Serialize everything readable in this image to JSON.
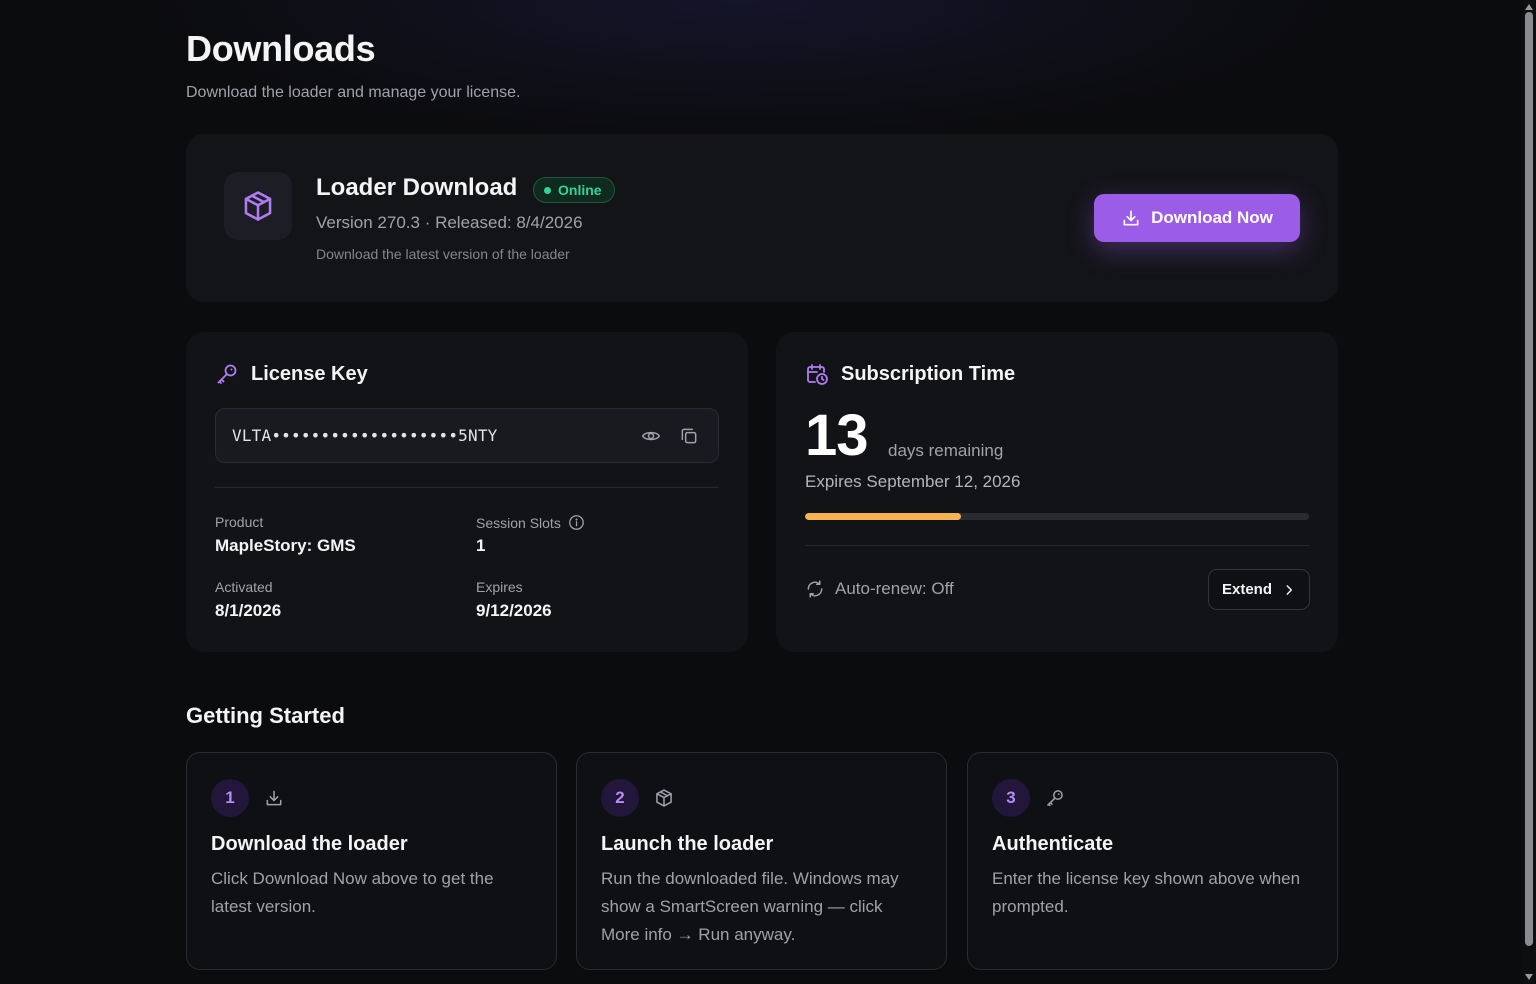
{
  "page": {
    "title": "Downloads",
    "subtitle": "Download the loader and manage your license."
  },
  "loader": {
    "title": "Loader Download",
    "status": "Online",
    "meta": "Version 270.3 · Released: 8/4/2026",
    "description": "Download the latest version of the loader",
    "button_label": "Download Now",
    "icon": "cube-icon"
  },
  "license": {
    "title": "License Key",
    "key_masked": "VLTA•••••••••••••••••••5NTY",
    "fields": {
      "product_label": "Product",
      "product_value": "MapleStory: GMS",
      "slots_label": "Session Slots",
      "slots_value": "1",
      "activated_label": "Activated",
      "activated_value": "8/1/2026",
      "expires_label": "Expires",
      "expires_value": "9/12/2026"
    }
  },
  "subscription": {
    "title": "Subscription Time",
    "days": "13",
    "days_label": "days remaining",
    "expires_text": "Expires September 12, 2026",
    "progress": 0.31,
    "auto_renew": "Auto-renew: Off",
    "extend_label": "Extend"
  },
  "getting_started": {
    "title": "Getting Started",
    "steps": [
      {
        "number": "1",
        "icon": "download-icon",
        "title": "Download the loader",
        "description": "Click Download Now above to get the latest version."
      },
      {
        "number": "2",
        "icon": "cube-icon",
        "title": "Launch the loader",
        "description": "Run the downloaded file. Windows may show a SmartScreen warning — click More info → Run anyway."
      },
      {
        "number": "3",
        "icon": "key-icon",
        "title": "Authenticate",
        "description": "Enter the license key shown above when prompted."
      }
    ]
  },
  "colors": {
    "accent": "#9b5ce8",
    "success": "#34d399",
    "progress": "#f5b451",
    "background": "#0b0c0e"
  }
}
